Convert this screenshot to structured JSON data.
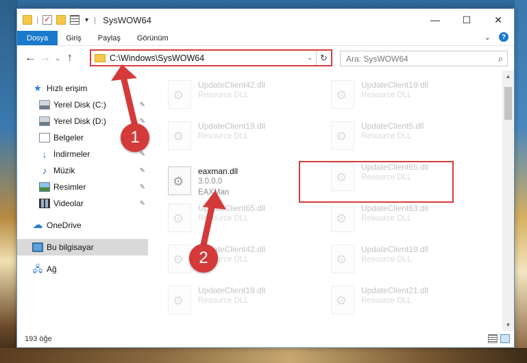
{
  "window": {
    "title": "SysWOW64",
    "controls": {
      "minimize": "—",
      "maximize": "☐",
      "close": "✕"
    }
  },
  "ribbon": {
    "tabs": [
      "Dosya",
      "Giriş",
      "Paylaş",
      "Görünüm"
    ],
    "expand_icon": "⌄",
    "help": "?"
  },
  "nav": {
    "back": "←",
    "forward": "→",
    "recent": "⌄",
    "up": "↑"
  },
  "address": {
    "path": "C:\\Windows\\SysWOW64",
    "dropdown": "⌄",
    "refresh": "↻"
  },
  "search": {
    "placeholder": "Ara: SysWOW64",
    "icon": "⌕"
  },
  "sidebar": {
    "items": [
      {
        "label": "Hızlı erişim",
        "icon": "star-icon"
      },
      {
        "label": "Yerel Disk (C:)",
        "icon": "drive-icon",
        "pinned": true
      },
      {
        "label": "Yerel Disk (D:)",
        "icon": "drive-icon",
        "pinned": true
      },
      {
        "label": "Belgeler",
        "icon": "documents-icon",
        "pinned": true
      },
      {
        "label": "İndirmeler",
        "icon": "downloads-icon",
        "pinned": true
      },
      {
        "label": "Müzik",
        "icon": "music-icon",
        "pinned": true
      },
      {
        "label": "Resimler",
        "icon": "pictures-icon",
        "pinned": true
      },
      {
        "label": "Videolar",
        "icon": "videos-icon",
        "pinned": true
      },
      {
        "label": "OneDrive",
        "icon": "cloud-icon"
      },
      {
        "label": "Bu bilgisayar",
        "icon": "computer-icon",
        "selected": true
      },
      {
        "label": "Ağ",
        "icon": "network-icon"
      }
    ],
    "pin_glyph": "📌"
  },
  "files": [
    {
      "name": "UpdateClient42.dll",
      "sub": "Resource DLL",
      "faded": true
    },
    {
      "name": "UpdateClient19.dll",
      "sub": "Resource DLL",
      "faded": true
    },
    {
      "name": "UpdateClient19.dll",
      "sub": "Resource DLL",
      "faded": true
    },
    {
      "name": "UpdateClient5.dll",
      "sub": "Resource DLL",
      "faded": true
    },
    {
      "name": "eaxman.dll",
      "sub": "3.0.0.0",
      "sub2": "EAXMan",
      "faded": false,
      "highlighted": true
    },
    {
      "name": "UpdateClient65.dll",
      "sub": "Resource DLL",
      "faded": true
    },
    {
      "name": "UpdateClient65.dll",
      "sub": "Resource DLL",
      "faded": true
    },
    {
      "name": "UpdateClient63.dll",
      "sub": "Resource DLL",
      "faded": true
    },
    {
      "name": "UpdateClient42.dll",
      "sub": "Resource DLL",
      "faded": true
    },
    {
      "name": "UpdateClient19.dll",
      "sub": "Resource DLL",
      "faded": true
    },
    {
      "name": "UpdateClient19.dll",
      "sub": "Resource DLL",
      "faded": true
    },
    {
      "name": "UpdateClient21.dll",
      "sub": "Resource DLL",
      "faded": true
    }
  ],
  "status": {
    "count": "193 öğe"
  },
  "annotations": {
    "step1": "1",
    "step2": "2",
    "color": "#d43a3a"
  },
  "colors": {
    "accent": "#1979ca",
    "highlight": "#d93a3a",
    "selected_bg": "#d9d9d9"
  }
}
